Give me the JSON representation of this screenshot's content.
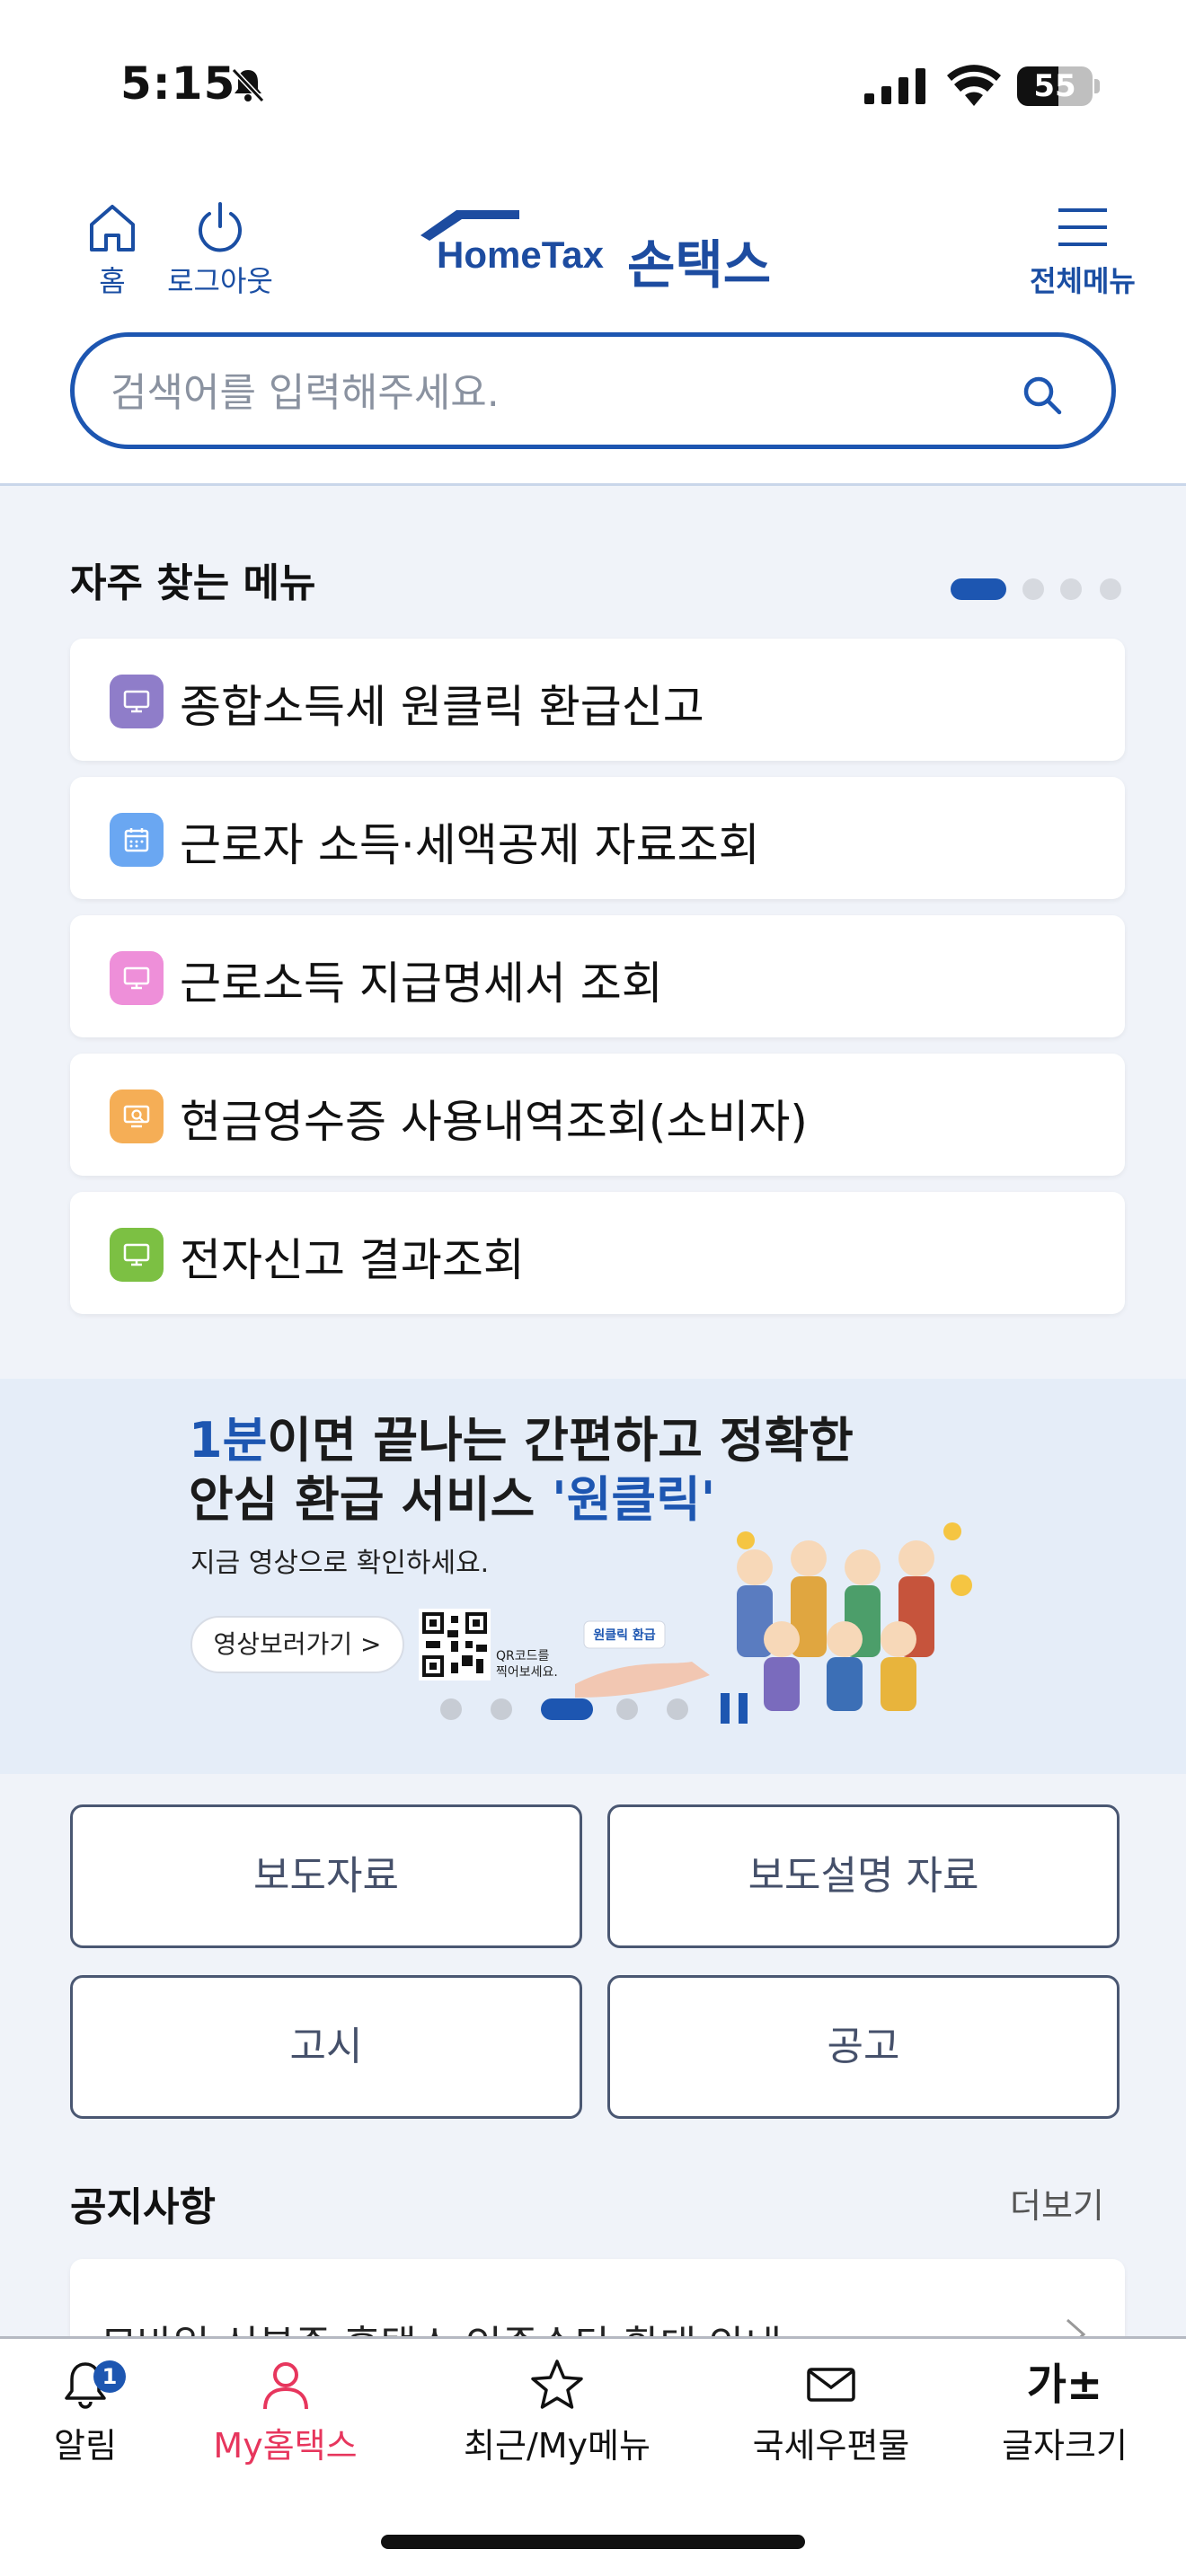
{
  "status_bar": {
    "time": "5:15",
    "battery_percent": "55",
    "battery_level": 0.55
  },
  "header": {
    "home_label": "홈",
    "logout_label": "로그아웃",
    "logo_text_en": "HomeTax",
    "logo_text_ko": "손택스",
    "menu_label": "전체메뉴"
  },
  "search": {
    "placeholder": "검색어를 입력해주세요."
  },
  "frequent_menu": {
    "title": "자주 찾는 메뉴",
    "items": [
      {
        "label": "종합소득세 원클릭 환급신고",
        "icon": "monitor-icon",
        "color": "#8f7dc9"
      },
      {
        "label": "근로자 소득·세액공제 자료조회",
        "icon": "calendar-icon",
        "color": "#6aa7f2"
      },
      {
        "label": "근로소득 지급명세서 조회",
        "icon": "monitor-icon",
        "color": "#ee8fd9"
      },
      {
        "label": "현금영수증 사용내역조회(소비자)",
        "icon": "search-doc-icon",
        "color": "#f5ae56"
      },
      {
        "label": "전자신고 결과조회",
        "icon": "monitor-icon",
        "color": "#7cc043"
      }
    ]
  },
  "banner": {
    "line1_highlight": "1분",
    "line1_rest": "이면 끝나는 간편하고 정확한",
    "line2_prefix": "안심 환급 서비스 ",
    "line2_highlight": "'원클릭'",
    "subtitle": "지금 영상으로 확인하세요.",
    "video_button": "영상보러가기 >",
    "qr_caption_1": "QR코드를",
    "qr_caption_2": "찍어보세요.",
    "tag_text": "원클릭 환급"
  },
  "quick_buttons": [
    "보도자료",
    "보도설명 자료",
    "고시",
    "공고"
  ],
  "notice": {
    "title": "공지사항",
    "more": "더보기",
    "first_item": "모바일 신분증 홈택스 인증수단 확대 안내"
  },
  "tab_bar": {
    "tabs": [
      {
        "label": "알림",
        "icon": "bell-icon"
      },
      {
        "label": "My홈택스",
        "icon": "person-icon"
      },
      {
        "label": "최근/My메뉴",
        "icon": "star-icon"
      },
      {
        "label": "국세우편물",
        "icon": "mail-icon"
      },
      {
        "label": "글자크기",
        "icon": "font-size-icon"
      }
    ],
    "alert_badge": "1",
    "font_size_glyph": "가±",
    "active_color": "#e7365d"
  }
}
